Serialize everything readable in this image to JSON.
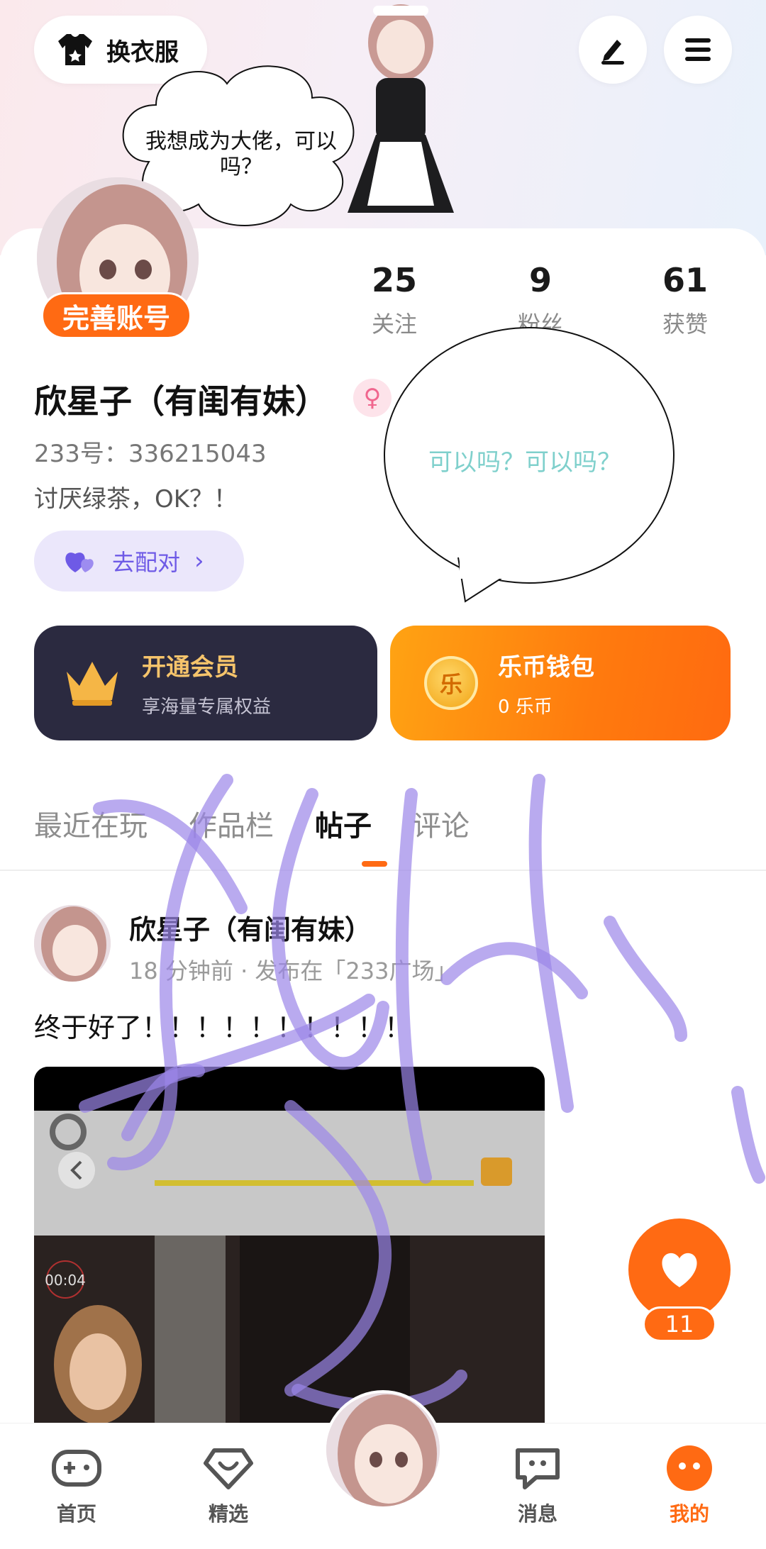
{
  "header": {
    "outfit_label": "换衣服",
    "thought_bubble": "我想成为大佬，可以吗？"
  },
  "profile": {
    "complete_badge": "完善账号",
    "stats": [
      {
        "num": "25",
        "label": "关注"
      },
      {
        "num": "9",
        "label": "粉丝"
      },
      {
        "num": "61",
        "label": "获赞"
      }
    ],
    "nickname": "欣星子（有闺有妹）",
    "gender_symbol": "♀",
    "uid": "233号：336215043",
    "bio": "讨厌绿茶，OK？！",
    "match_label": "去配对",
    "match_chevron": "›",
    "speech_bubble": "可以吗？可以吗？"
  },
  "cards": {
    "vip_title": "开通会员",
    "vip_sub": "享海量专属权益",
    "wallet_coin": "乐",
    "wallet_title": "乐币钱包",
    "wallet_sub": "0 乐币"
  },
  "tabs": [
    "最近在玩",
    "作品栏",
    "帖子",
    "评论"
  ],
  "active_tab": "帖子",
  "post": {
    "author": "欣星子（有闺有妹）",
    "meta": "18 分钟前 · 发布在「233广场」",
    "body": "终于好了！！！！！！！！！！",
    "video_timer": "00:04",
    "like_count": "11"
  },
  "nav": [
    {
      "label": "首页",
      "icon": "gamepad-icon"
    },
    {
      "label": "精选",
      "icon": "heart-badge-icon"
    },
    {
      "label": "",
      "icon": "avatar-center"
    },
    {
      "label": "消息",
      "icon": "chat-icon"
    },
    {
      "label": "我的",
      "icon": "me-icon"
    }
  ],
  "colors": {
    "accent": "#ff6a13",
    "vip_bg": "#2b2a40",
    "match_bg": "#ebe7fb",
    "scribble": "#9b86e8"
  }
}
